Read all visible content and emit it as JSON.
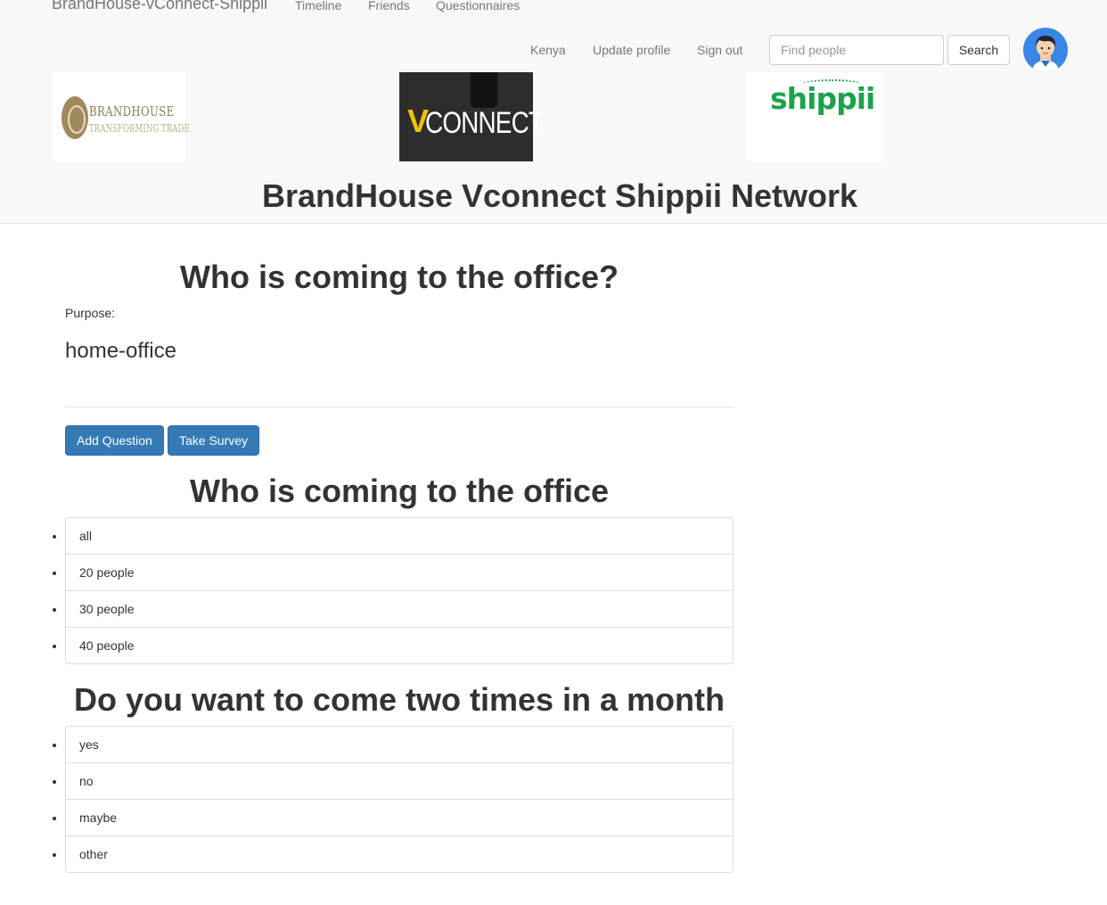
{
  "navbar": {
    "brand": "BrandHouse-vConnect-Shippii",
    "links": [
      "Timeline",
      "Friends",
      "Questionnaires"
    ],
    "right_links": [
      "Kenya",
      "Update profile",
      "Sign out"
    ],
    "search_placeholder": "Find people",
    "search_button": "Search"
  },
  "logos": {
    "brandhouse": {
      "name": "BRANDHOUSE",
      "tagline": "TRANSFORMING TRADE"
    },
    "vconnect": {
      "mark": "V",
      "text": "CONNECT"
    },
    "shippii": {
      "text": "shippii"
    }
  },
  "site_title": "BrandHouse Vconnect Shippii Network",
  "questionnaire": {
    "title": "Who is coming to the office?",
    "purpose_label": "Purpose:",
    "purpose_value": "home-office",
    "add_question_label": "Add Question",
    "take_survey_label": "Take Survey"
  },
  "questions": [
    {
      "title": "Who is coming to the office",
      "options": [
        "all",
        "20 people",
        "30 people",
        "40 people"
      ]
    },
    {
      "title": "Do you want to come two times in a month",
      "options": [
        "yes",
        "no",
        "maybe",
        "other"
      ]
    }
  ],
  "colors": {
    "primary": "#337ab7",
    "navbar_bg": "#f8f8f8",
    "shippii_green": "#1aa34a",
    "vconnect_yellow": "#f2c200",
    "avatar_bg": "#3a86e8"
  }
}
